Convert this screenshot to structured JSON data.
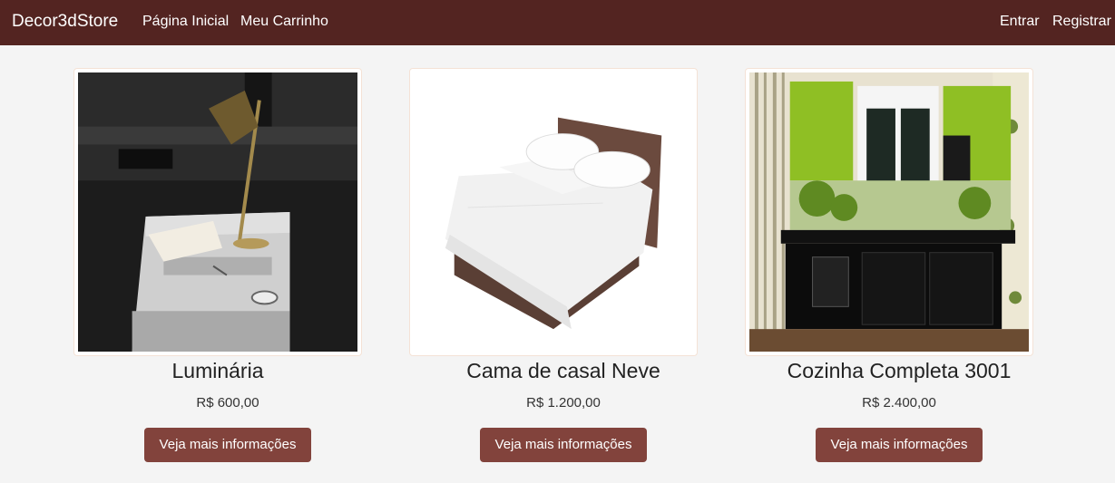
{
  "nav": {
    "brand": "Decor3dStore",
    "home": "Página Inicial",
    "cart": "Meu Carrinho",
    "login": "Entrar",
    "register": "Registrar"
  },
  "products": [
    {
      "name": "Luminária",
      "price": "R$ 600,00",
      "button": "Veja mais informações",
      "image_icon": "desk-lamp-image"
    },
    {
      "name": "Cama de casal Neve",
      "price": "R$ 1.200,00",
      "button": "Veja mais informações",
      "image_icon": "bed-image"
    },
    {
      "name": "Cozinha Completa 3001",
      "price": "R$ 2.400,00",
      "button": "Veja mais informações",
      "image_icon": "kitchen-image"
    }
  ],
  "colors": {
    "navbar": "#532421",
    "button": "#82433c",
    "background": "#f4f4f4"
  }
}
